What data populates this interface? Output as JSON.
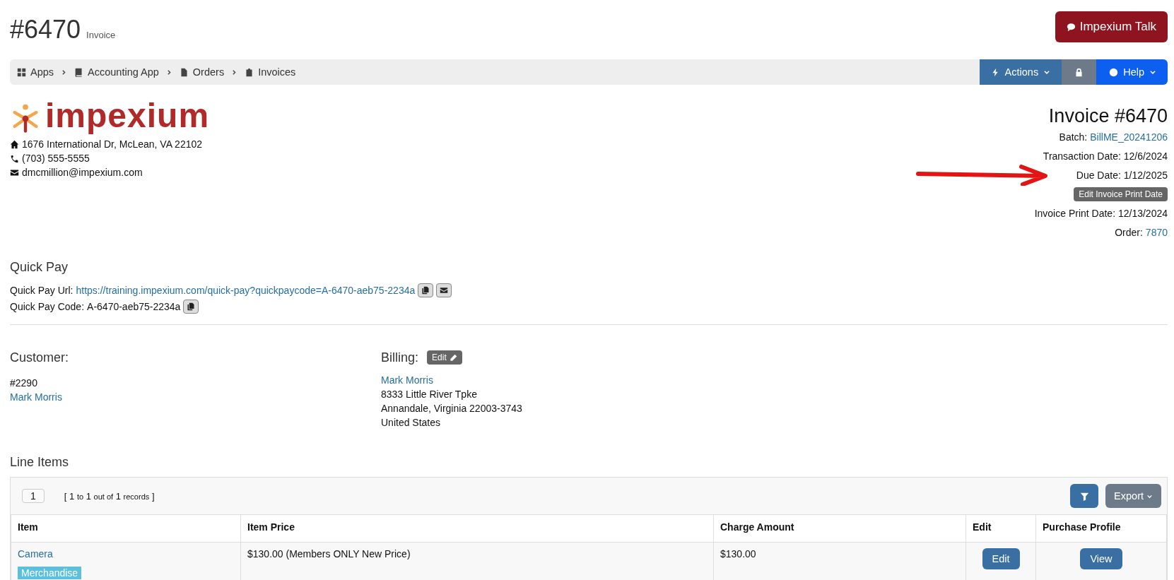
{
  "page_header": {
    "number": "#6470",
    "subtitle": "Invoice",
    "talk_button": "Impexium Talk"
  },
  "breadcrumb": [
    {
      "label": "Apps"
    },
    {
      "label": "Accounting App"
    },
    {
      "label": "Orders"
    },
    {
      "label": "Invoices"
    }
  ],
  "toolbar": {
    "actions": "Actions",
    "help": "Help"
  },
  "company": {
    "logo": "impexium",
    "address": "1676 International Dr, McLean, VA 22102",
    "phone": "(703) 555-5555",
    "email": "dmcmillion@impexium.com"
  },
  "invoice": {
    "title": "Invoice #6470",
    "batch_label": "Batch:",
    "batch": "BillME_20241206",
    "transaction_date": "Transaction Date: 12/6/2024",
    "due_date": "Due Date: 1/12/2025",
    "edit_print_date_button": "Edit Invoice Print Date",
    "print_date": "Invoice Print Date: 12/13/2024",
    "order_label": "Order:",
    "order": "7870"
  },
  "quick_pay": {
    "heading": "Quick Pay",
    "url_label": "Quick Pay Url:",
    "url": "https://training.impexium.com/quick-pay?quickpaycode=A-6470-aeb75-2234a",
    "code_label": "Quick Pay Code:",
    "code": "A-6470-aeb75-2234a"
  },
  "customer": {
    "heading": "Customer:",
    "number": "#2290",
    "name": "Mark Morris"
  },
  "billing": {
    "heading": "Billing:",
    "edit_button": "Edit",
    "name": "Mark Morris",
    "lines": [
      "8333 Little River Tpke",
      "Annandale, Virginia 22003-3743",
      "United States"
    ]
  },
  "line_items": {
    "heading": "Line Items",
    "page": "1",
    "records": [
      "[",
      "1",
      "to",
      "1",
      "out of",
      "1",
      "records",
      "]"
    ],
    "export_button": "Export",
    "columns": [
      "Item",
      "Item Price",
      "Charge Amount",
      "Edit",
      "Purchase Profile"
    ],
    "rows": [
      {
        "item": "Camera",
        "tag": "Merchandise",
        "price": "$130.00 (Members ONLY New Price)",
        "charge": "$130.00",
        "edit": "Edit",
        "view": "View"
      }
    ]
  }
}
